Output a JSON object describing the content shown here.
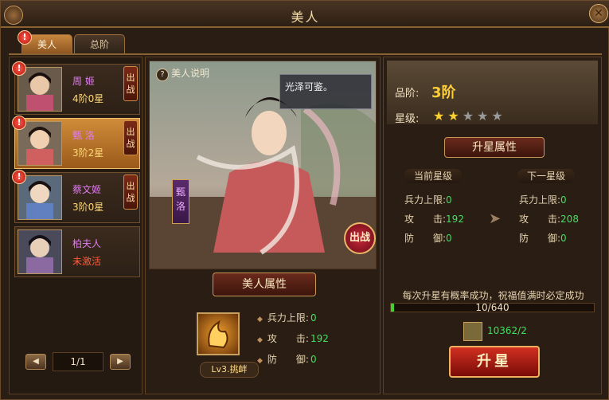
{
  "window": {
    "title": "美人",
    "close_label": "✕"
  },
  "tabs": [
    {
      "label": "美人",
      "badge": "!"
    },
    {
      "label": "总阶"
    }
  ],
  "list": {
    "items": [
      {
        "name": "周 姬",
        "stars": "4阶0星",
        "badge": "!",
        "tag": "出战"
      },
      {
        "name": "甄 洛",
        "stars": "3阶2星",
        "badge": "!",
        "tag": "出战"
      },
      {
        "name": "蔡文姬",
        "stars": "3阶0星",
        "badge": "!",
        "tag": "出战"
      },
      {
        "name": "柏夫人",
        "stars": "未激活"
      }
    ],
    "pager": {
      "text": "1/1",
      "prev": "◀",
      "next": "▶"
    }
  },
  "center": {
    "help_link": "美人说明",
    "help_icon": "?",
    "quote": "光泽可鉴。",
    "vertical_name": "甄洛",
    "fight_button": "出战",
    "attr_header": "美人属性",
    "skill_label": "Lv3.挑衅",
    "attrs": [
      {
        "label": "兵力上限:",
        "value": "0"
      },
      {
        "label": "攻　　击:",
        "value": "192"
      },
      {
        "label": "防　　御:",
        "value": "0"
      }
    ]
  },
  "right": {
    "grade_label": "品阶:",
    "grade_value": "3阶",
    "star_label": "星级:",
    "star_count": 2,
    "star_total": 5,
    "upgrade_header": "升星属性",
    "current_label": "当前星级",
    "next_label": "下一星级",
    "current": [
      {
        "label": "兵力上限:",
        "value": "0"
      },
      {
        "label": "攻　　击:",
        "value": "192"
      },
      {
        "label": "防　　御:",
        "value": "0"
      }
    ],
    "next": [
      {
        "label": "兵力上限:",
        "value": "0"
      },
      {
        "label": "攻　　击:",
        "value": "208"
      },
      {
        "label": "防　　御:",
        "value": "0"
      }
    ],
    "desc": "每次升星有概率成功，祝福值满时必定成功",
    "progress_text": "10/640",
    "progress_fraction": 0.0156,
    "material_text": "10362/2",
    "upgrade_button": "升星"
  },
  "colors": {
    "accent": "#ffce36",
    "value_green": "#40e060",
    "name_purple": "#e07cf0"
  }
}
